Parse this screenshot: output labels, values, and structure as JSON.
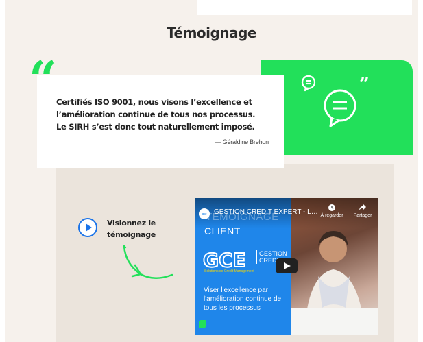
{
  "section": {
    "heading": "Témoignage"
  },
  "testimonial": {
    "quote_mark": "“",
    "text": "Certifiés ISO 9001, nous visons l’excellence et l’amélioration continue de tous nos processus. Le SIRH s’est donc tout naturellement imposé.",
    "author": "— Géraldine Brehon",
    "closing_quote": "”"
  },
  "watch": {
    "label": "Visionnez le témoignage"
  },
  "video": {
    "title": "GESTION CREDIT EXPERT - L'excellen...",
    "ghost_title": "TÉMOIGNAGE",
    "client_label": "CLIENT",
    "logo_text": "GCE",
    "gestion_line1": "GESTION",
    "gestion_line2": "CREDIT E",
    "logo_sub": "Solutions de Credit Management",
    "tagline": "Viser l'excellence par l'amélioration continue de tous les processus",
    "watch_later": "À regarder",
    "share": "Partager"
  },
  "colors": {
    "accent_green": "#22e05a",
    "play_blue": "#1a73e8",
    "video_blue": "#1f86ea"
  },
  "icons": [
    "chat-icon",
    "chat-large-icon",
    "play-circle-icon",
    "curved-arrow-icon",
    "clock-icon",
    "share-icon"
  ]
}
